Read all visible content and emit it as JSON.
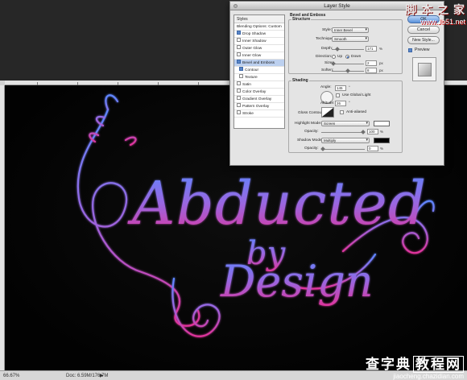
{
  "dialog": {
    "title": "Layer Style",
    "styles_list": [
      {
        "label": "Styles",
        "checkbox": false,
        "checked": false,
        "selected": false,
        "sub": false,
        "header": true
      },
      {
        "label": "Blending Options: Custom",
        "checkbox": false,
        "checked": false,
        "selected": false,
        "sub": false,
        "header": false
      },
      {
        "label": "Drop Shadow",
        "checkbox": true,
        "checked": true,
        "selected": false,
        "sub": false,
        "header": false
      },
      {
        "label": "Inner Shadow",
        "checkbox": true,
        "checked": false,
        "selected": false,
        "sub": false,
        "header": false
      },
      {
        "label": "Outer Glow",
        "checkbox": true,
        "checked": false,
        "selected": false,
        "sub": false,
        "header": false
      },
      {
        "label": "Inner Glow",
        "checkbox": true,
        "checked": false,
        "selected": false,
        "sub": false,
        "header": false
      },
      {
        "label": "Bevel and Emboss",
        "checkbox": true,
        "checked": true,
        "selected": true,
        "sub": false,
        "header": false
      },
      {
        "label": "Contour",
        "checkbox": true,
        "checked": true,
        "selected": false,
        "sub": true,
        "header": false
      },
      {
        "label": "Texture",
        "checkbox": true,
        "checked": false,
        "selected": false,
        "sub": true,
        "header": false
      },
      {
        "label": "Satin",
        "checkbox": true,
        "checked": false,
        "selected": false,
        "sub": false,
        "header": false
      },
      {
        "label": "Color Overlay",
        "checkbox": true,
        "checked": false,
        "selected": false,
        "sub": false,
        "header": false
      },
      {
        "label": "Gradient Overlay",
        "checkbox": true,
        "checked": false,
        "selected": false,
        "sub": false,
        "header": false
      },
      {
        "label": "Pattern Overlay",
        "checkbox": true,
        "checked": false,
        "selected": false,
        "sub": false,
        "header": false
      },
      {
        "label": "Stroke",
        "checkbox": true,
        "checked": false,
        "selected": false,
        "sub": false,
        "header": false
      }
    ],
    "bevel_title": "Bevel and Emboss",
    "structure": {
      "title": "Structure",
      "style_label": "Style:",
      "style_value": "Inner Bevel",
      "technique_label": "Technique:",
      "technique_value": "Smooth",
      "depth_label": "Depth:",
      "depth_value": "171",
      "depth_unit": "%",
      "depth_level": 0.17,
      "direction_label": "Direction:",
      "direction_up": "Up",
      "direction_down": "Down",
      "size_label": "Size:",
      "size_value": "2",
      "size_unit": "px",
      "size_level": 0.02,
      "soften_label": "Soften:",
      "soften_value": "8",
      "soften_unit": "px",
      "soften_level": 0.5
    },
    "shading": {
      "title": "Shading",
      "angle_label": "Angle:",
      "angle_value": "145",
      "angle_unit": "°",
      "global_light": "Use Global Light",
      "altitude_label": "Altitude:",
      "altitude_value": "26",
      "altitude_unit": "°",
      "gloss_label": "Gloss Contour:",
      "anti_aliased": "Anti-aliased",
      "highlight_label": "Highlight Mode:",
      "highlight_value": "Screen",
      "hl_opacity_label": "Opacity:",
      "hl_opacity_value": "100",
      "hl_opacity_unit": "%",
      "hl_opacity_level": 1.0,
      "shadow_label": "Shadow Mode:",
      "shadow_value": "Multiply",
      "sh_opacity_label": "Opacity:",
      "sh_opacity_value": "0",
      "sh_opacity_unit": "%",
      "sh_opacity_level": 0.0,
      "highlight_color": "#ffffff",
      "shadow_color": "#000000"
    },
    "buttons": {
      "ok": "OK",
      "cancel": "Cancel",
      "new_style": "New Style...",
      "preview": "Preview"
    }
  },
  "statusbar": {
    "zoom": "66.67%",
    "doc": "Doc: 6.59M/176.7M",
    "arrow": "▶"
  },
  "watermark_top": {
    "cn": "脚 本 之 家",
    "url": "www.Jb51.net"
  },
  "watermark_bottom": {
    "cn_a": "查字典",
    "cn_b": "教程网",
    "url": "jiaocheng.chazidian.com"
  },
  "artwork": {
    "line1": "Abducted",
    "line2": "by",
    "line3": "Design",
    "colors": {
      "top": "#5e86ff",
      "mid": "#9a66e0",
      "bottom": "#e0339a"
    }
  }
}
